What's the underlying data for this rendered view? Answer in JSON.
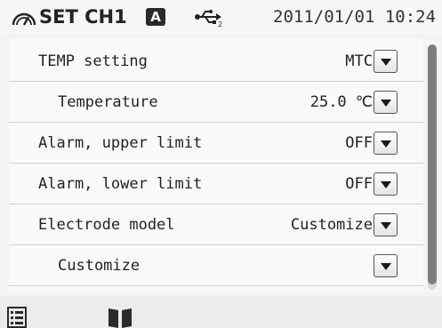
{
  "header": {
    "title": "SET CH1",
    "mode_badge": "A",
    "datetime": "2011/01/01 10:24",
    "icons": [
      "instrument-gauge-icon",
      "usb-icon"
    ]
  },
  "settings": {
    "rows": [
      {
        "label": "TEMP setting",
        "value": "MTC",
        "control": "chevron-down-icon"
      },
      {
        "label": "Temperature",
        "value": "25.0 ℃",
        "control": "chevron-down-icon"
      },
      {
        "label": "Alarm, upper limit",
        "value": "OFF",
        "control": "chevron-down-icon"
      },
      {
        "label": "Alarm, lower limit",
        "value": "OFF",
        "control": "chevron-down-icon"
      },
      {
        "label": "Electrode model",
        "value": "Customize",
        "control": "chevron-down-icon"
      },
      {
        "label": "Customize",
        "value": "",
        "control": "chevron-down-icon"
      }
    ]
  },
  "toolbar": {
    "icons": [
      "menu-list-icon",
      "manual-book-icon"
    ]
  },
  "scrollbar": {
    "visible_fraction": 0.98
  },
  "colors": {
    "background": "#f4f4f4",
    "badge": "#2a2a2a",
    "scroll_thumb": "#7d7d7d"
  }
}
